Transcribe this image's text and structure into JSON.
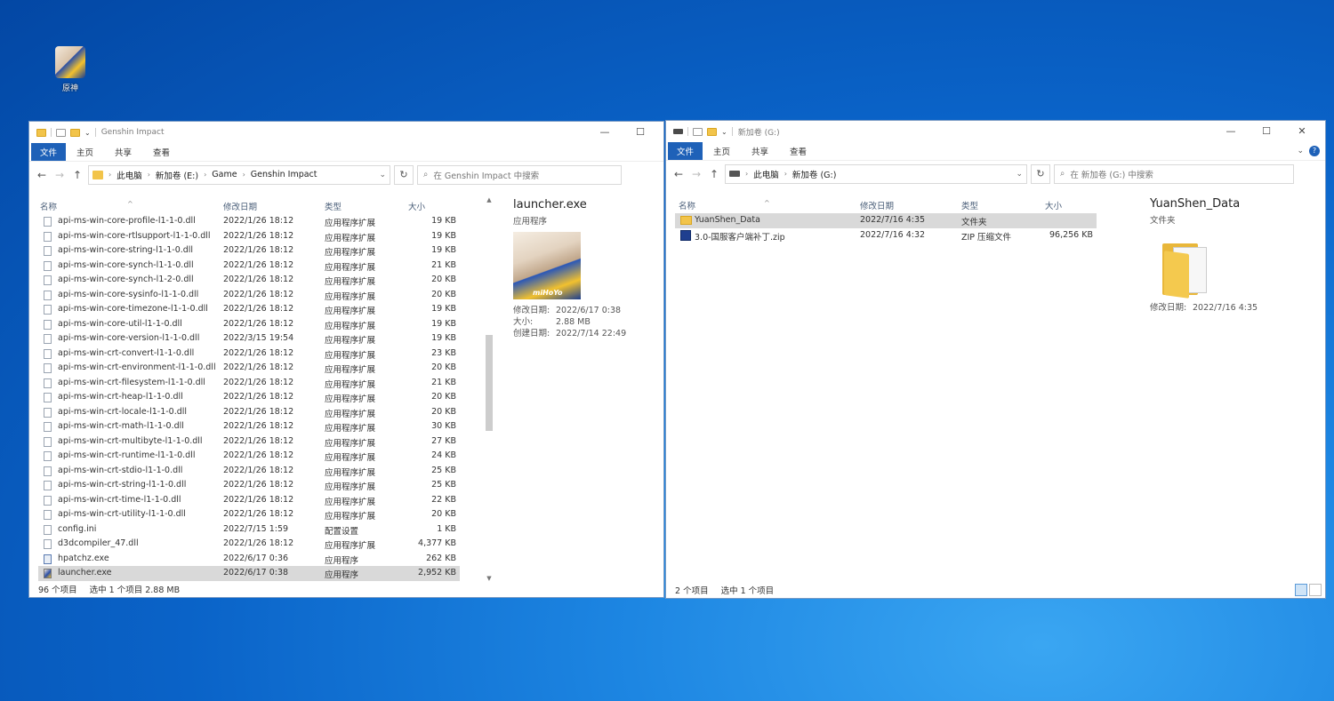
{
  "desktop": {
    "icon_label": "原神"
  },
  "left": {
    "title": "Genshin Impact",
    "ribbon": {
      "file": "文件",
      "home": "主页",
      "share": "共享",
      "view": "查看"
    },
    "address": {
      "crumbs": [
        "此电脑",
        "新加卷 (E:)",
        "Game",
        "Genshin Impact"
      ]
    },
    "search_placeholder": "在 Genshin Impact 中搜索",
    "columns": {
      "name": "名称",
      "date": "修改日期",
      "type": "类型",
      "size": "大小"
    },
    "files": [
      {
        "name": "api-ms-win-core-profile-l1-1-0.dll",
        "date": "2022/1/26 18:12",
        "type": "应用程序扩展",
        "size": "19 KB",
        "icon": "dll"
      },
      {
        "name": "api-ms-win-core-rtlsupport-l1-1-0.dll",
        "date": "2022/1/26 18:12",
        "type": "应用程序扩展",
        "size": "19 KB",
        "icon": "dll"
      },
      {
        "name": "api-ms-win-core-string-l1-1-0.dll",
        "date": "2022/1/26 18:12",
        "type": "应用程序扩展",
        "size": "19 KB",
        "icon": "dll"
      },
      {
        "name": "api-ms-win-core-synch-l1-1-0.dll",
        "date": "2022/1/26 18:12",
        "type": "应用程序扩展",
        "size": "21 KB",
        "icon": "dll"
      },
      {
        "name": "api-ms-win-core-synch-l1-2-0.dll",
        "date": "2022/1/26 18:12",
        "type": "应用程序扩展",
        "size": "20 KB",
        "icon": "dll"
      },
      {
        "name": "api-ms-win-core-sysinfo-l1-1-0.dll",
        "date": "2022/1/26 18:12",
        "type": "应用程序扩展",
        "size": "20 KB",
        "icon": "dll"
      },
      {
        "name": "api-ms-win-core-timezone-l1-1-0.dll",
        "date": "2022/1/26 18:12",
        "type": "应用程序扩展",
        "size": "19 KB",
        "icon": "dll"
      },
      {
        "name": "api-ms-win-core-util-l1-1-0.dll",
        "date": "2022/1/26 18:12",
        "type": "应用程序扩展",
        "size": "19 KB",
        "icon": "dll"
      },
      {
        "name": "api-ms-win-core-version-l1-1-0.dll",
        "date": "2022/3/15 19:54",
        "type": "应用程序扩展",
        "size": "19 KB",
        "icon": "dll"
      },
      {
        "name": "api-ms-win-crt-convert-l1-1-0.dll",
        "date": "2022/1/26 18:12",
        "type": "应用程序扩展",
        "size": "23 KB",
        "icon": "dll"
      },
      {
        "name": "api-ms-win-crt-environment-l1-1-0.dll",
        "date": "2022/1/26 18:12",
        "type": "应用程序扩展",
        "size": "20 KB",
        "icon": "dll"
      },
      {
        "name": "api-ms-win-crt-filesystem-l1-1-0.dll",
        "date": "2022/1/26 18:12",
        "type": "应用程序扩展",
        "size": "21 KB",
        "icon": "dll"
      },
      {
        "name": "api-ms-win-crt-heap-l1-1-0.dll",
        "date": "2022/1/26 18:12",
        "type": "应用程序扩展",
        "size": "20 KB",
        "icon": "dll"
      },
      {
        "name": "api-ms-win-crt-locale-l1-1-0.dll",
        "date": "2022/1/26 18:12",
        "type": "应用程序扩展",
        "size": "20 KB",
        "icon": "dll"
      },
      {
        "name": "api-ms-win-crt-math-l1-1-0.dll",
        "date": "2022/1/26 18:12",
        "type": "应用程序扩展",
        "size": "30 KB",
        "icon": "dll"
      },
      {
        "name": "api-ms-win-crt-multibyte-l1-1-0.dll",
        "date": "2022/1/26 18:12",
        "type": "应用程序扩展",
        "size": "27 KB",
        "icon": "dll"
      },
      {
        "name": "api-ms-win-crt-runtime-l1-1-0.dll",
        "date": "2022/1/26 18:12",
        "type": "应用程序扩展",
        "size": "24 KB",
        "icon": "dll"
      },
      {
        "name": "api-ms-win-crt-stdio-l1-1-0.dll",
        "date": "2022/1/26 18:12",
        "type": "应用程序扩展",
        "size": "25 KB",
        "icon": "dll"
      },
      {
        "name": "api-ms-win-crt-string-l1-1-0.dll",
        "date": "2022/1/26 18:12",
        "type": "应用程序扩展",
        "size": "25 KB",
        "icon": "dll"
      },
      {
        "name": "api-ms-win-crt-time-l1-1-0.dll",
        "date": "2022/1/26 18:12",
        "type": "应用程序扩展",
        "size": "22 KB",
        "icon": "dll"
      },
      {
        "name": "api-ms-win-crt-utility-l1-1-0.dll",
        "date": "2022/1/26 18:12",
        "type": "应用程序扩展",
        "size": "20 KB",
        "icon": "dll"
      },
      {
        "name": "config.ini",
        "date": "2022/7/15 1:59",
        "type": "配置设置",
        "size": "1 KB",
        "icon": "ini"
      },
      {
        "name": "d3dcompiler_47.dll",
        "date": "2022/1/26 18:12",
        "type": "应用程序扩展",
        "size": "4,377 KB",
        "icon": "dll"
      },
      {
        "name": "hpatchz.exe",
        "date": "2022/6/17 0:36",
        "type": "应用程序",
        "size": "262 KB",
        "icon": "exe"
      },
      {
        "name": "launcher.exe",
        "date": "2022/6/17 0:38",
        "type": "应用程序",
        "size": "2,952 KB",
        "icon": "launch",
        "selected": true
      }
    ],
    "preview": {
      "name": "launcher.exe",
      "type": "应用程序",
      "thumb_logo": "miHoYo",
      "meta": [
        {
          "k": "修改日期:",
          "v": "2022/6/17 0:38"
        },
        {
          "k": "大小:",
          "v": "2.88 MB"
        },
        {
          "k": "创建日期:",
          "v": "2022/7/14 22:49"
        }
      ]
    },
    "status": {
      "count": "96 个项目",
      "selected": "选中 1 个项目  2.88 MB"
    }
  },
  "right": {
    "title": "新加卷 (G:)",
    "ribbon": {
      "file": "文件",
      "home": "主页",
      "share": "共享",
      "view": "查看"
    },
    "address": {
      "crumbs": [
        "此电脑",
        "新加卷 (G:)"
      ]
    },
    "search_placeholder": "在 新加卷 (G:) 中搜索",
    "columns": {
      "name": "名称",
      "date": "修改日期",
      "type": "类型",
      "size": "大小"
    },
    "files": [
      {
        "name": "YuanShen_Data",
        "date": "2022/7/16 4:35",
        "type": "文件夹",
        "size": "",
        "icon": "fold",
        "selected": true
      },
      {
        "name": "3.0-国服客户端补丁.zip",
        "date": "2022/7/16 4:32",
        "type": "ZIP 压缩文件",
        "size": "96,256 KB",
        "icon": "zip"
      }
    ],
    "preview": {
      "name": "YuanShen_Data",
      "type": "文件夹",
      "meta": [
        {
          "k": "修改日期:",
          "v": "2022/7/16 4:35"
        }
      ]
    },
    "status": {
      "count": "2 个项目",
      "selected": "选中 1 个项目"
    }
  },
  "icons": {
    "back": "←",
    "forward": "→",
    "up": "↑",
    "refresh": "↻",
    "search": "⌕",
    "minimize": "—",
    "maximize": "☐",
    "close": "✕",
    "chevron": "›",
    "dropdown": "⌄"
  }
}
